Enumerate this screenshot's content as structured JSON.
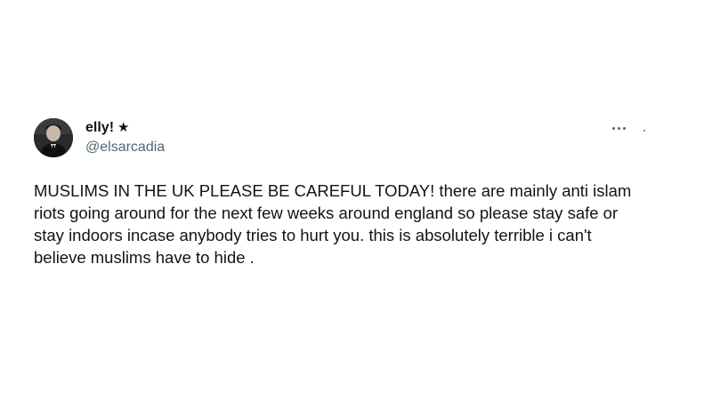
{
  "tweet": {
    "author": {
      "display_name": "elly!",
      "badge_icon": "star-icon",
      "badge_glyph": "★",
      "handle": "@elsarcadia"
    },
    "more_icon": "more-options-icon",
    "text": "MUSLIMS IN THE UK PLEASE BE CAREFUL TODAY! there are mainly anti islam riots going around for the next few weeks around england so please stay safe or stay indoors incase anybody tries to hurt you. this is absolutely terrible i can't believe muslims have to hide ."
  },
  "colors": {
    "text_primary": "#0f1419",
    "text_secondary": "#536471",
    "background": "#ffffff"
  }
}
